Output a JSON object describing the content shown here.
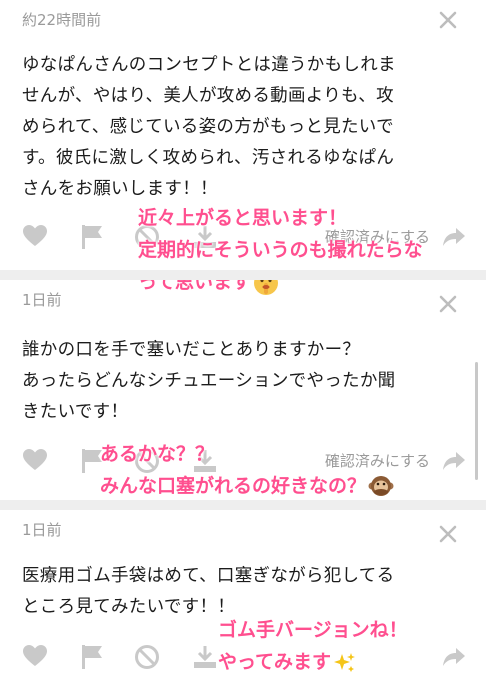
{
  "comments": [
    {
      "time": "約22時間前",
      "lines": [
        "ゆなぱんさんのコンセプトとは違うかもしれま",
        "せんが、やはり、美人が攻める動画よりも、攻",
        "められて、感じている姿の方がもっと見たいで",
        "す。彼氏に激しく攻められ、汚されるゆなぱん",
        "さんをお願いします！！"
      ],
      "confirm_label": "確認済みにする",
      "reply_lines": [
        "近々上がると思います！",
        "定期的にそういうのも撮れたらな",
        "って思います"
      ],
      "reply_emoji": "shushing-face-emoji"
    },
    {
      "time": "1日前",
      "lines": [
        "誰かの口を手で塞いだことありますかー？",
        "あったらどんなシチュエーションでやったか聞",
        "きたいです！"
      ],
      "confirm_label": "確認済みにする",
      "reply_lines": [
        "あるかな？？",
        "みんな口塞がれるの好きなの？"
      ],
      "reply_emoji": "speak-no-evil-monkey-emoji"
    },
    {
      "time": "1日前",
      "lines": [
        "医療用ゴム手袋はめて、口塞ぎながら犯してる",
        "ところ見てみたいです！！"
      ],
      "reply_lines": [
        "ゴム手バージョンね！",
        "やってみます"
      ],
      "reply_emoji": "sparkles-emoji"
    }
  ],
  "icons": [
    "heart-icon",
    "flag-icon",
    "block-icon",
    "download-icon",
    "share-icon",
    "close-icon"
  ],
  "colors": {
    "reply_text": "#ff4f8f",
    "icon_gray": "#c9c9c9",
    "meta_gray": "#9a9a9a",
    "separator": "#eeeeee"
  }
}
